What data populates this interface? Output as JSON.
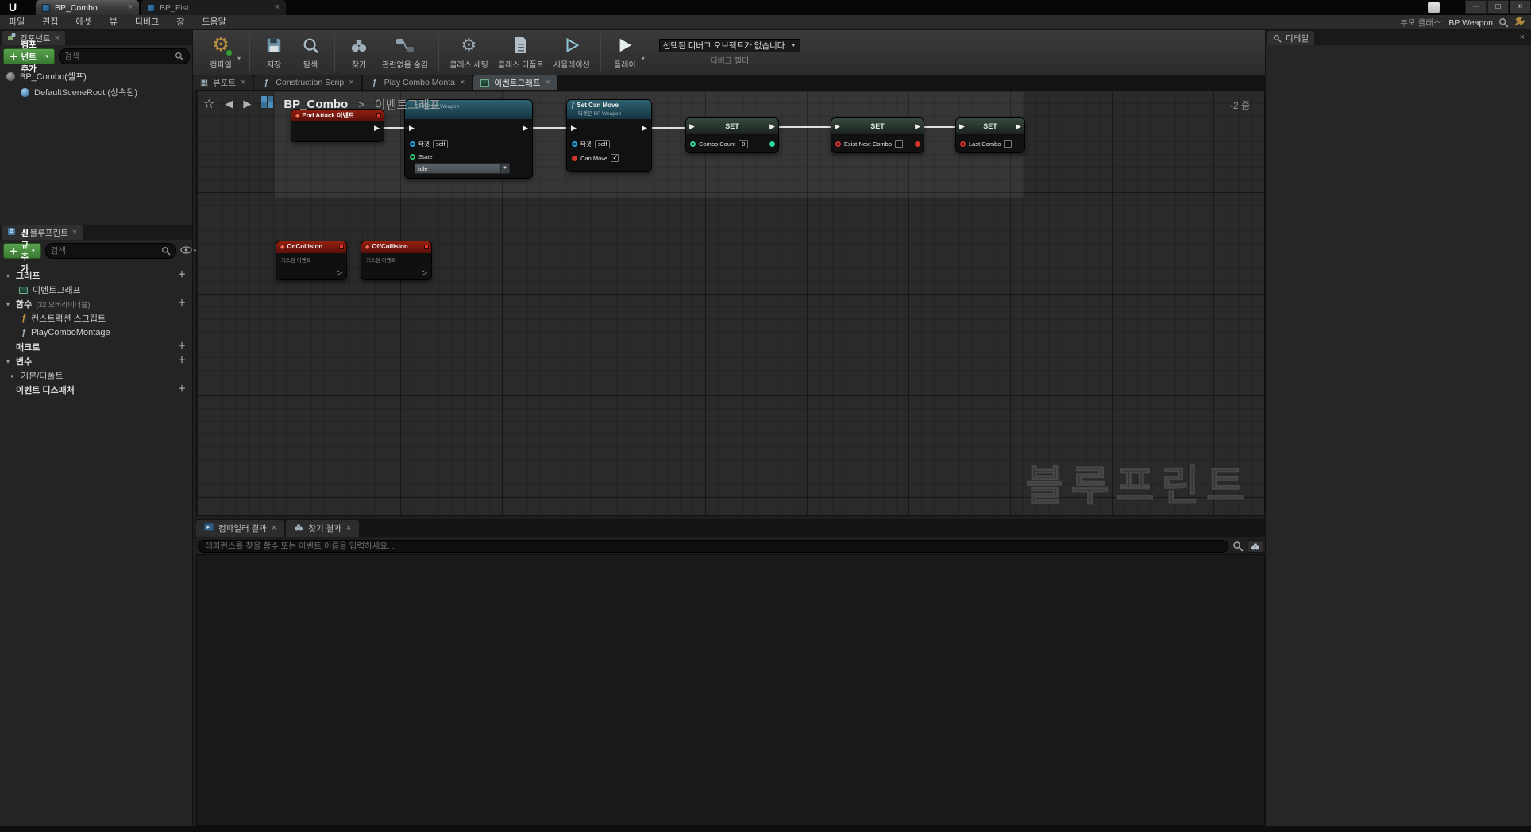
{
  "icons": {
    "close": "×",
    "minimize": "─",
    "maximize": "□",
    "caret_down": "▾",
    "dropdown_arrow": "▼",
    "plus": "＋",
    "star": "☆",
    "arrow_back": "◀",
    "arrow_forward": "▶",
    "gear": "⚙",
    "chevron": ">",
    "tri_open": "▾",
    "tri_closed": "▸",
    "fn": "ƒ",
    "exec_filled": "▶",
    "exec_hollow": "▷",
    "diamond": "◆",
    "play": "▶",
    "unreal_logo": "U"
  },
  "window": {
    "tabs": [
      {
        "label": "BP_Combo"
      },
      {
        "label": "BP_Fist"
      }
    ]
  },
  "menubar": {
    "items": [
      "파일",
      "편집",
      "에셋",
      "뷰",
      "디버그",
      "창",
      "도움말"
    ],
    "parent_class_label": "부모 클래스:",
    "parent_class_value": "BP Weapon"
  },
  "components_panel": {
    "title": "컴포넌트",
    "add_button": "컴포넌트 추가",
    "search_placeholder": "검색",
    "items": [
      {
        "label": "BP_Combo(셀프)"
      },
      {
        "label": "DefaultSceneRoot (상속됨)"
      }
    ]
  },
  "my_blueprint": {
    "title": "내 블루프린트",
    "add_button": "신규 추가",
    "search_placeholder": "검색",
    "rows": [
      {
        "label": "그래프"
      },
      {
        "label": "이벤트그래프"
      },
      {
        "label": "함수",
        "suffix": "(32 오버라이더블)"
      },
      {
        "label": "컨스트럭션 스크립트"
      },
      {
        "label": "PlayComboMontage"
      },
      {
        "label": "매크로"
      },
      {
        "label": "변수"
      },
      {
        "label": "기본/디폴트"
      },
      {
        "label": "이벤트 디스패처"
      }
    ]
  },
  "toolbar": {
    "compile": "컴파일",
    "save": "저장",
    "browse": "탐색",
    "find": "찾기",
    "hide_unrelated": "관련없음 숨김",
    "class_settings": "클래스 세팅",
    "class_defaults": "클래스 디폴트",
    "simulation": "시뮬레이션",
    "play": "플레이",
    "debug_object": "선택된 디버그 오브젝트가 없습니다.",
    "debug_filter": "디버그 필터"
  },
  "doc_tabs": [
    {
      "label": "뷰포트"
    },
    {
      "label": "Construction Scrip"
    },
    {
      "label": "Play Combo Monta"
    },
    {
      "label": "이벤트그래프"
    }
  ],
  "graph": {
    "breadcrumb_root": "BP_Combo",
    "breadcrumb_leaf": "이벤트그래프",
    "zoom": "-2 줌",
    "watermark": "블루프린트",
    "nodes": {
      "end_attack": {
        "title": "End Attack 이벤트"
      },
      "set_state": {
        "subtitle": "타겟은 BP Weapon",
        "target_label": "타겟",
        "target_value": "self",
        "state_label": "State",
        "state_value": "idle"
      },
      "set_can_move": {
        "title": "Set Can Move",
        "subtitle": "타겟은 BP Weapon",
        "target_label": "타겟",
        "target_value": "self",
        "bool_label": "Can Move",
        "checked": true
      },
      "set_combo_count": {
        "title": "SET",
        "pin_label": "Combo Count",
        "value": "0"
      },
      "set_exist_next_combo": {
        "title": "SET",
        "pin_label": "Exist Next Combo",
        "checked": false
      },
      "set_last_combo": {
        "title": "SET",
        "pin_label": "Last Combo",
        "checked": false
      },
      "on_collision": {
        "title": "OnCollision",
        "subtitle": "커스텀 이벤트"
      },
      "off_collision": {
        "title": "OffCollision",
        "subtitle": "커스텀 이벤트"
      }
    }
  },
  "bottom_panel": {
    "tabs": [
      {
        "label": "컴파일러 결과"
      },
      {
        "label": "찾기 결과"
      }
    ],
    "search_placeholder": "레퍼런스를 찾을 함수 또는 이벤트 이름을 입력하세요..."
  },
  "details_panel": {
    "title": "디테일"
  }
}
